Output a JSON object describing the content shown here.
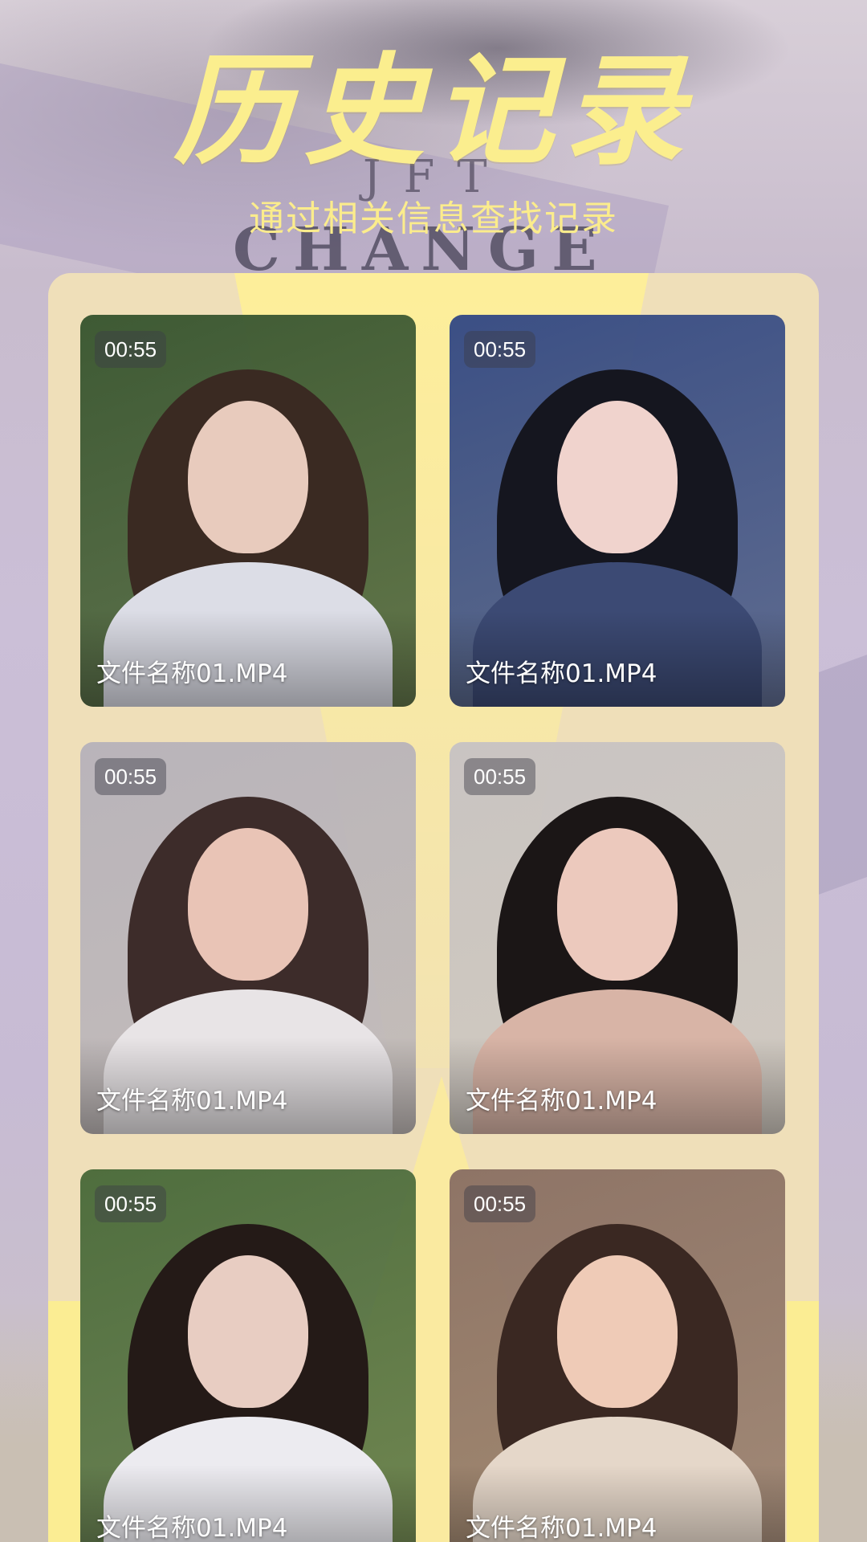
{
  "header": {
    "title": "历史记录",
    "subtitle": "通过相关信息查找记录",
    "deco_small": "JFT",
    "deco_large": "CHANGE"
  },
  "records": [
    {
      "duration": "00:55",
      "filename": "文件名称01.MP4",
      "palette": {
        "bg": "#3e5a34",
        "hair": "#3a2a22",
        "face": "#e8cbbd",
        "body": "#dcdde6"
      }
    },
    {
      "duration": "00:55",
      "filename": "文件名称01.MP4",
      "palette": {
        "bg": "#3b4f85",
        "hair": "#15161f",
        "face": "#f0d3cd",
        "body": "#3c4a74"
      }
    },
    {
      "duration": "00:55",
      "filename": "文件名称01.MP4",
      "palette": {
        "bg": "#b9b4ba",
        "hair": "#3d2c2a",
        "face": "#e9c4b6",
        "body": "#e8e4e6"
      }
    },
    {
      "duration": "00:55",
      "filename": "文件名称01.MP4",
      "palette": {
        "bg": "#c9c4c2",
        "hair": "#1b1616",
        "face": "#ecc9bd",
        "body": "#d8b4a6"
      }
    },
    {
      "duration": "00:55",
      "filename": "文件名称01.MP4",
      "palette": {
        "bg": "#4f6e3e",
        "hair": "#241a17",
        "face": "#e8cdc2",
        "body": "#ecebf0"
      }
    },
    {
      "duration": "00:55",
      "filename": "文件名称01.MP4",
      "palette": {
        "bg": "#8e7466",
        "hair": "#3a2822",
        "face": "#efcbb7",
        "body": "#e5d7c9"
      }
    }
  ]
}
